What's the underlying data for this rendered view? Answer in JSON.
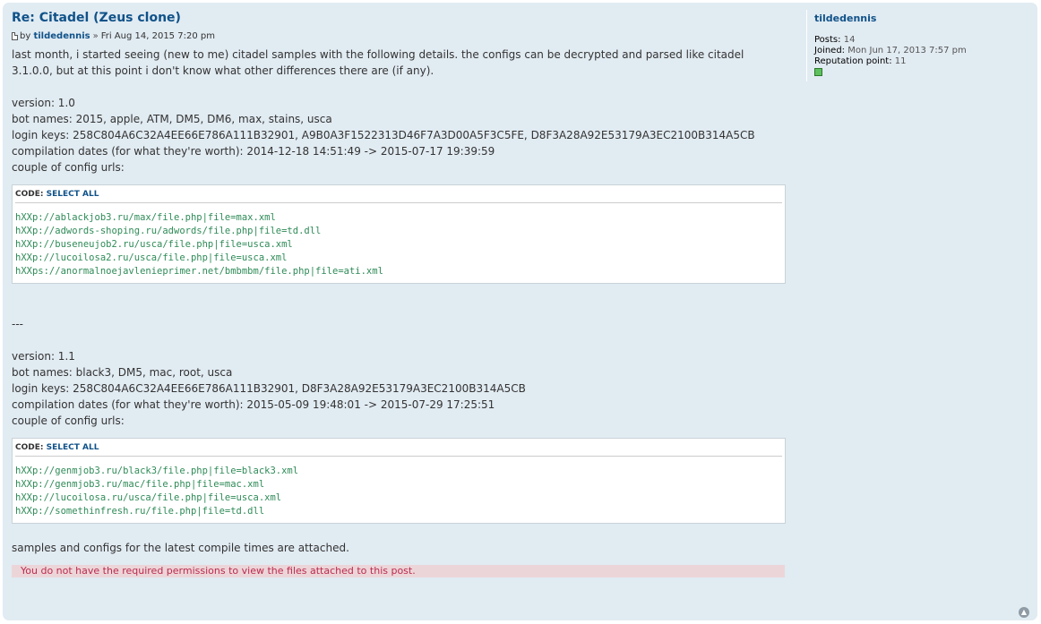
{
  "post": {
    "title": "Re: Citadel (Zeus clone)",
    "by_label": "by",
    "author": "tildedennis",
    "date": "Fri Aug 14, 2015 7:20 pm",
    "intro": "last month, i started seeing (new to me) citadel samples with the following details. the configs can be decrypted and parsed like citadel 3.1.0.0, but at this point i don't know what other differences there are (if any).",
    "block1": {
      "version": "version: 1.0",
      "bot_names": "bot names: 2015, apple, ATM, DM5, DM6, max, stains, usca",
      "login_keys": "login keys: 258C804A6C32A4EE66E786A111B32901, A9B0A3F1522313D46F7A3D00A5F3C5FE, D8F3A28A92E53179A3EC2100B314A5CB",
      "compilation": "compilation dates (for what they're worth): 2014-12-18 14:51:49 -> 2015-07-17 19:39:59",
      "urls_label": "couple of config urls:"
    },
    "code1": {
      "header_label": "CODE:",
      "select_all": "SELECT ALL",
      "lines": [
        "hXXp://ablackjob3.ru/max/file.php|file=max.xml",
        "hXXp://adwords-shoping.ru/adwords/file.php|file=td.dll",
        "hXXp://buseneujob2.ru/usca/file.php|file=usca.xml",
        "hXXp://lucoilosa2.ru/usca/file.php|file=usca.xml",
        "hXXps://anormalnoejavlenieprimer.net/bmbmbm/file.php|file=ati.xml"
      ]
    },
    "separator": "---",
    "block2": {
      "version": "version: 1.1",
      "bot_names": "bot names: black3, DM5, mac, root, usca",
      "login_keys": "login keys: 258C804A6C32A4EE66E786A111B32901, D8F3A28A92E53179A3EC2100B314A5CB",
      "compilation": "compilation dates (for what they're worth): 2015-05-09 19:48:01 -> 2015-07-29 17:25:51",
      "urls_label": "couple of config urls:"
    },
    "code2": {
      "header_label": "CODE:",
      "select_all": "SELECT ALL",
      "lines": [
        "hXXp://genmjob3.ru/black3/file.php|file=black3.xml",
        "hXXp://genmjob3.ru/mac/file.php|file=mac.xml",
        "hXXp://lucoilosa.ru/usca/file.php|file=usca.xml",
        "hXXp://somethinfresh.ru/file.php|file=td.dll"
      ]
    },
    "closing": "samples and configs for the latest compile times are attached.",
    "permission_notice": "You do not have the required permissions to view the files attached to this post."
  },
  "profile": {
    "username": "tildedennis",
    "posts_label": "Posts:",
    "posts_value": "14",
    "joined_label": "Joined:",
    "joined_value": "Mon Jun 17, 2013 7:57 pm",
    "rep_label": "Reputation point:",
    "rep_value": "11"
  },
  "icons": {
    "post_icon": "post-icon",
    "top_icon": "arrow-up-icon",
    "rep_indicator": "reputation-square-icon"
  },
  "colors": {
    "post_bg": "#e1ebf2",
    "link": "#105289",
    "code_text": "#2e8b57",
    "notice_bg": "#ecd5d8",
    "notice_text": "#bc2a4d"
  }
}
